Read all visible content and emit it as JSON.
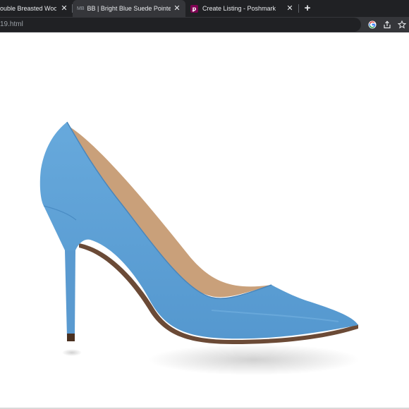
{
  "browser": {
    "tabs": [
      {
        "label": "ouble Breasted Wool E",
        "favicon": "none",
        "active": false
      },
      {
        "label": "BB | Bright Blue Suede Pointed Toe",
        "favicon": "MB",
        "active": true
      },
      {
        "label": "Create Listing - Poshmark",
        "favicon": "poshmark-icon",
        "active": false
      }
    ],
    "close_glyph": "✕",
    "new_tab_glyph": "+",
    "address": "19.html"
  },
  "product_image": {
    "subject": "bright-blue-suede-pointed-toe-pump",
    "colors": {
      "suede": "#5fa3d8",
      "suede_shadow": "#4a8cc4",
      "lining": "#c9a07a",
      "sole": "#6b4a36",
      "heel_tip": "#4a3020"
    }
  }
}
